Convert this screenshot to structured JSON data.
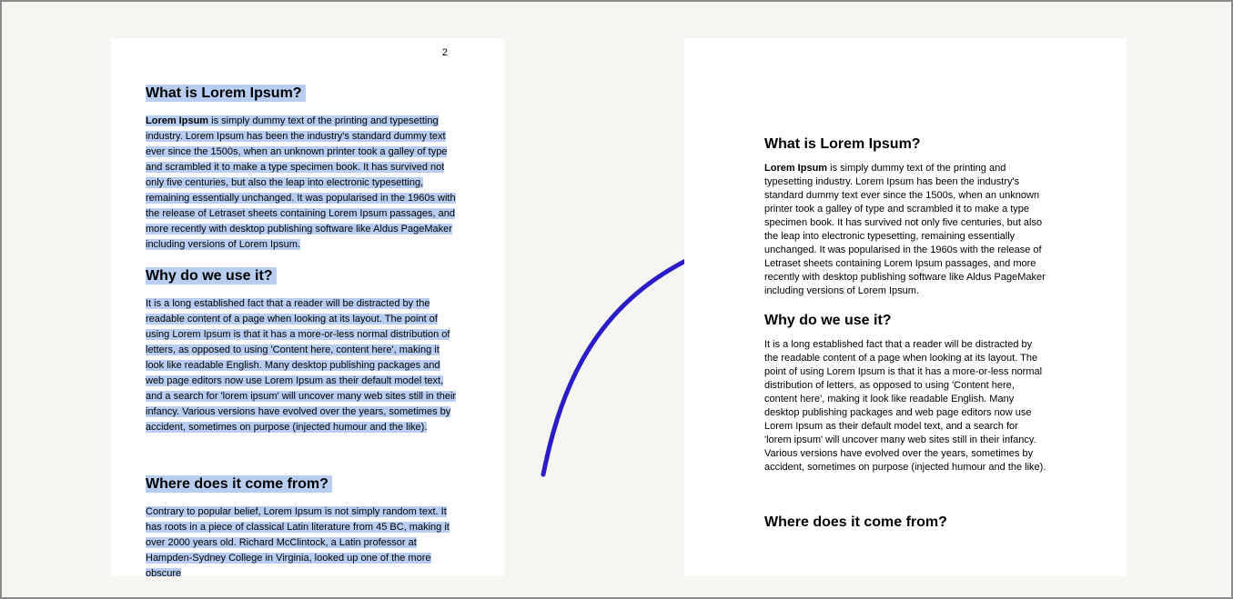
{
  "left_page": {
    "page_number": "2",
    "sections": [
      {
        "title": "What is Lorem Ipsum?",
        "lead": "Lorem Ipsum",
        "body_rest": " is simply dummy text of the printing and typesetting industry. Lorem Ipsum has been the industry's standard dummy text ever since the 1500s, when an unknown printer took a galley of type and scrambled it to make a type specimen book. It has survived not only five centuries, but also the leap into electronic typesetting, remaining essentially unchanged. It was popularised in the 1960s with the release of Letraset sheets containing Lorem Ipsum passages, and more recently with desktop publishing software like Aldus PageMaker including versions of Lorem Ipsum."
      },
      {
        "title": "Why do we use it?",
        "body": "It is a long established fact that a reader will be distracted by the readable content of a page when looking at its layout. The point of using Lorem Ipsum is that it has a more-or-less normal distribution of letters, as opposed to using 'Content here, content here', making it look like readable English. Many desktop publishing packages and web page editors now use Lorem Ipsum as their default model text, and a search for 'lorem ipsum' will uncover many web sites still in their infancy. Various versions have evolved over the years, sometimes by accident, sometimes on purpose (injected humour and the like)."
      },
      {
        "title": "Where does it come from?",
        "body": "Contrary to popular belief, Lorem Ipsum is not simply random text. It has roots in a piece of classical Latin literature from 45 BC, making it over 2000 years old. Richard McClintock, a Latin professor at Hampden-Sydney College in Virginia, looked up one of the more obscure"
      }
    ]
  },
  "right_page": {
    "sections": [
      {
        "title": "What is Lorem Ipsum?",
        "lead": "Lorem Ipsum",
        "body_rest": " is simply dummy text of the printing and typesetting industry. Lorem Ipsum has been the industry's standard dummy text ever since the 1500s, when an unknown printer took a galley of type and scrambled it to make a type specimen book. It has survived not only five centuries, but also the leap into electronic typesetting, remaining essentially unchanged. It was popularised in the 1960s with the release of Letraset sheets containing Lorem Ipsum passages, and more recently with desktop publishing software like Aldus PageMaker including versions of Lorem Ipsum."
      },
      {
        "title": "Why do we use it?",
        "body": "It is a long established fact that a reader will be distracted by the readable content of a page when looking at its layout. The point of using Lorem Ipsum is that it has a more-or-less normal distribution of letters, as opposed to using 'Content here, content here', making it look like readable English. Many desktop publishing packages and web page editors now use Lorem Ipsum as their default model text, and a search for 'lorem ipsum' will uncover many web sites still in their infancy. Various versions have evolved over the years, sometimes by accident, sometimes on purpose (injected humour and the like)."
      },
      {
        "title": "Where does it come from?"
      }
    ]
  }
}
